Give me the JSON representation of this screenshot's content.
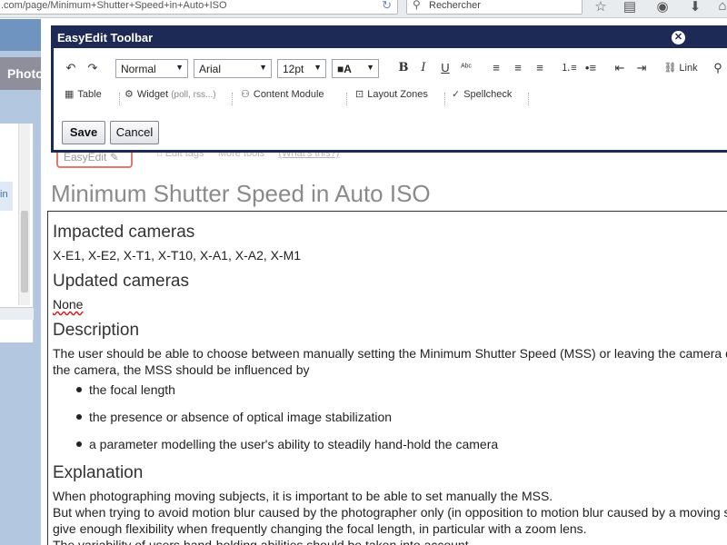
{
  "browser": {
    "url": ".com/page/Minimum+Shutter+Speed+in+Auto+ISO",
    "search_placeholder": "Rechercher"
  },
  "app": {
    "photos_tab": "Photos",
    "side_highlight": "in"
  },
  "page": {
    "easyedit_badge": "EasyEdit",
    "faint_links": [
      "Edit tags",
      "More tools",
      "(What's this?)"
    ],
    "title": "Minimum Shutter Speed in Auto ISO"
  },
  "toolbar": {
    "title": "EasyEdit Toolbar",
    "style_select": "Normal",
    "font_select": "Arial",
    "size_select": "12pt",
    "link_label": "Link",
    "table_label": "Table",
    "widget_label": "Widget",
    "widget_hint": "(poll, rss...)",
    "content_module_label": "Content Module",
    "layout_zones_label": "Layout Zones",
    "spellcheck_label": "Spellcheck",
    "save_label": "Save",
    "cancel_label": "Cancel"
  },
  "document": {
    "impacted_heading": "Impacted cameras",
    "impacted_text": "X-E1, X-E2, X-T1, X-T10, X-A1, X-A2, X-M1",
    "updated_heading": "Updated cameras",
    "updated_text": "None",
    "description_heading": "Description",
    "description_line1": "The user should be able to choose between manually setting the Minimum Shutter Speed (MSS) or leaving the camera decide.",
    "description_line2": "the camera, the MSS should be influenced by",
    "description_items": [
      "the focal length",
      "the presence or absence of optical image stabilization",
      "a parameter modelling the user's ability to steadily hand-hold the camera"
    ],
    "explanation_heading": "Explanation",
    "explanation_lines": [
      "When photographing moving subjects, it is important to be able to set manually the MSS.",
      "But when trying to avoid motion blur caused by the photographer only (in opposition to motion blur caused by a moving subject),",
      "give enough flexibility when frequently changing the focal length, in particular with a zoom lens.",
      "The variability of users hand-holding abilities should be taken into account."
    ]
  }
}
